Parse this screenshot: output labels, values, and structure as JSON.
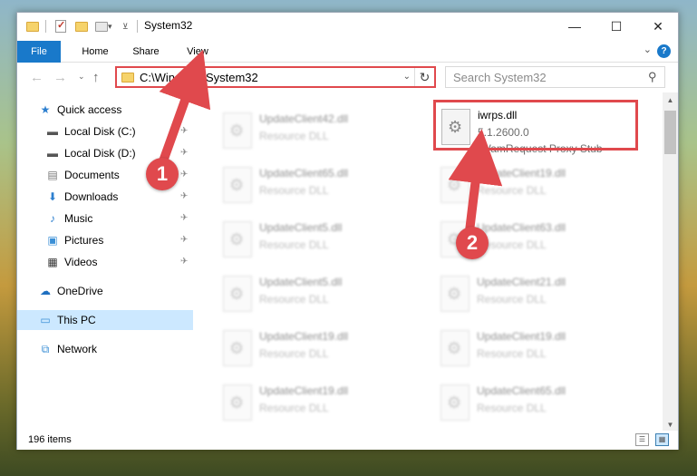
{
  "window": {
    "title": "System32",
    "controls": {
      "minimize": "—",
      "maximize": "☐",
      "close": "✕"
    }
  },
  "ribbon": {
    "tabs": [
      "File",
      "Home",
      "Share",
      "View"
    ],
    "help": "?",
    "expand": "⌄"
  },
  "nav": {
    "back": "←",
    "forward": "→",
    "recent": "⌄",
    "up": "↑",
    "address": "C:\\Windows\\System32",
    "address_dropdown": "⌄",
    "refresh": "↻",
    "search_placeholder": "Search System32",
    "search_icon": "⚲"
  },
  "navpane": {
    "items": [
      {
        "label": "Quick access",
        "icon": "star-icon",
        "glyph": "★",
        "pinned": false
      },
      {
        "label": "Local Disk (C:)",
        "icon": "drive-icon",
        "glyph": "▬",
        "pinned": true
      },
      {
        "label": "Local Disk (D:)",
        "icon": "drive-icon",
        "glyph": "▬",
        "pinned": true
      },
      {
        "label": "Documents",
        "icon": "documents-icon",
        "glyph": "▤",
        "pinned": true
      },
      {
        "label": "Downloads",
        "icon": "downloads-icon",
        "glyph": "⬇",
        "pinned": true
      },
      {
        "label": "Music",
        "icon": "music-icon",
        "glyph": "♪",
        "pinned": true
      },
      {
        "label": "Pictures",
        "icon": "pictures-icon",
        "glyph": "▣",
        "pinned": true
      },
      {
        "label": "Videos",
        "icon": "videos-icon",
        "glyph": "▦",
        "pinned": true
      },
      {
        "label": "OneDrive",
        "icon": "onedrive-icon",
        "glyph": "☁",
        "pinned": false
      },
      {
        "label": "This PC",
        "icon": "computer-icon",
        "glyph": "▭",
        "pinned": false
      },
      {
        "label": "Network",
        "icon": "network-icon",
        "glyph": "⧉",
        "pinned": false
      }
    ],
    "pin_glyph": "📌"
  },
  "files": {
    "highlighted": {
      "name": "iwrps.dll",
      "version": "5.1.2600.0",
      "description": "IWamRequest Proxy Stub"
    },
    "left_column": [
      {
        "name": "UpdateClient42.dll",
        "type": "Resource DLL"
      },
      {
        "name": "UpdateClient65.dll",
        "type": "Resource DLL"
      },
      {
        "name": "UpdateClient5.dll",
        "type": "Resource DLL"
      },
      {
        "name": "UpdateClient5.dll",
        "type": "Resource DLL"
      },
      {
        "name": "UpdateClient19.dll",
        "type": "Resource DLL"
      },
      {
        "name": "UpdateClient19.dll",
        "type": "Resource DLL"
      }
    ],
    "right_column": [
      {
        "name": "UpdateClient19.dll",
        "type": "Resource DLL"
      },
      {
        "name": "UpdateClient63.dll",
        "type": "Resource DLL"
      },
      {
        "name": "UpdateClient21.dll",
        "type": "Resource DLL"
      },
      {
        "name": "UpdateClient19.dll",
        "type": "Resource DLL"
      },
      {
        "name": "UpdateClient65.dll",
        "type": "Resource DLL"
      }
    ]
  },
  "status": {
    "count": "196 items"
  },
  "annotations": {
    "step1": "1",
    "step2": "2",
    "color": "#e0494d"
  }
}
